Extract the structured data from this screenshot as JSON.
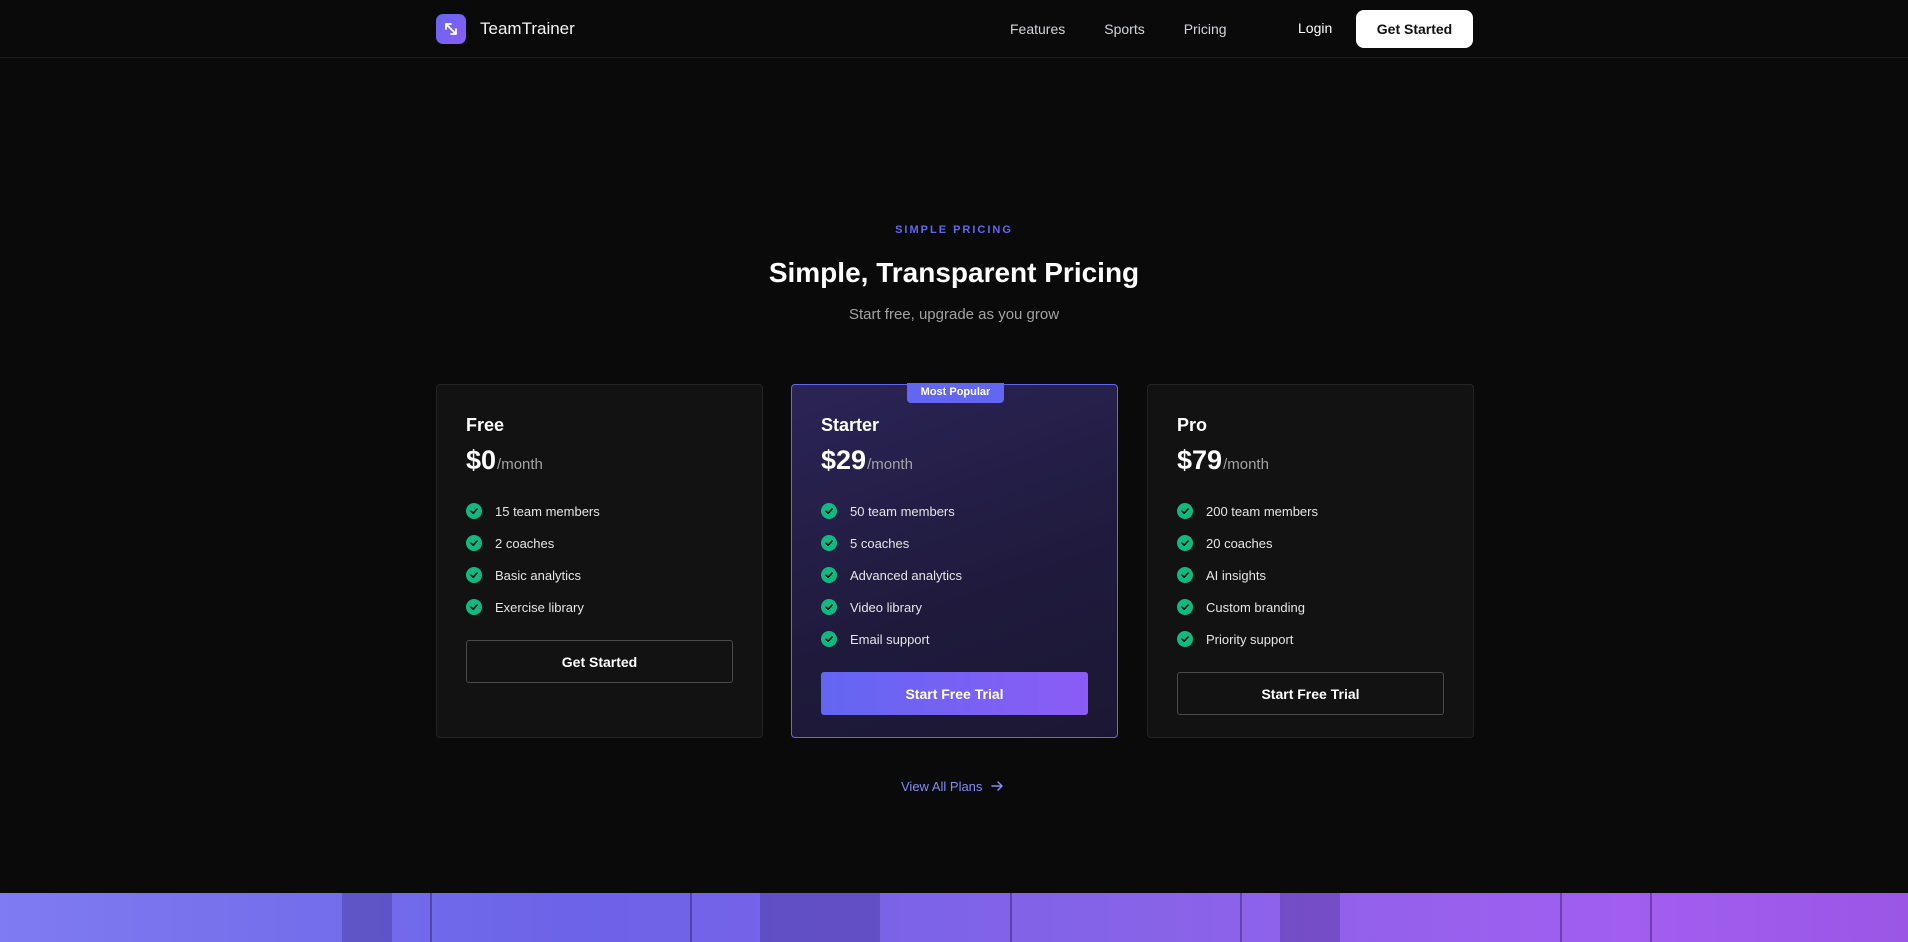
{
  "nav": {
    "brand": "TeamTrainer",
    "links": [
      "Features",
      "Sports",
      "Pricing"
    ],
    "login": "Login",
    "cta": "Get Started"
  },
  "hero": {
    "eyebrow": "SIMPLE PRICING",
    "title": "Simple, Transparent Pricing",
    "subtitle": "Start free, upgrade as you grow"
  },
  "plans": [
    {
      "name": "Free",
      "price": "$0",
      "period": "/month",
      "features": [
        "15 team members",
        "2 coaches",
        "Basic analytics",
        "Exercise library"
      ],
      "button": "Get Started"
    },
    {
      "name": "Starter",
      "badge": "Most Popular",
      "price": "$29",
      "period": "/month",
      "features": [
        "50 team members",
        "5 coaches",
        "Advanced analytics",
        "Video library",
        "Email support"
      ],
      "button": "Start Free Trial"
    },
    {
      "name": "Pro",
      "price": "$79",
      "period": "/month",
      "features": [
        "200 team members",
        "20 coaches",
        "AI insights",
        "Custom branding",
        "Priority support"
      ],
      "button": "Start Free Trial"
    }
  ],
  "view_all": "View All Plans",
  "icons": {
    "logo": "expand-arrows-icon",
    "check": "check-circle-icon",
    "arrow": "arrow-right-icon"
  },
  "colors": {
    "accent": "#6366f1",
    "accent_secondary": "#8b5cf6",
    "check": "#10b981",
    "background": "#0a0a0a",
    "card": "#121212"
  }
}
